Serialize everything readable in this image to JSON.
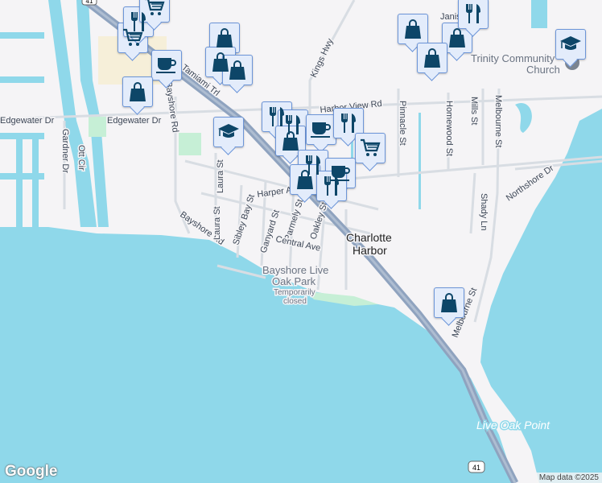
{
  "map": {
    "roads": [
      "Tamiami Trl",
      "Edgewater Dr",
      "Edgewater Dr",
      "Bayshore Rd",
      "Bayshore Rd",
      "Kings Hwy",
      "Harbor View Rd",
      "Gardner Dr",
      "Ott Cir",
      "Laura St",
      "Sibley Bay St",
      "Ganyard St",
      "Parmely St",
      "Oakley St",
      "Harper Ave",
      "Central Ave",
      "Pinnacle St",
      "Homewood St",
      "Mills St",
      "Melbourne St",
      "Melbourne St",
      "Shady Ln",
      "Northshore Dr",
      "Laura St",
      "Janis"
    ],
    "places": {
      "town_line1": "Charlotte",
      "town_line2": "Harbor",
      "park_line1": "Bayshore Live",
      "park_line2": "Oak Park",
      "park_status_line1": "Temporarily",
      "park_status_line2": "closed",
      "church_line1": "Trinity Community",
      "church_line2": "Church",
      "point": "Live Oak Point"
    },
    "shields": [
      "41",
      "41"
    ],
    "markers": [
      "cart",
      "fork",
      "cart",
      "shop",
      "shop",
      "shop",
      "coffee",
      "shop",
      "school",
      "fork",
      "fork",
      "shop",
      "coffee",
      "fork",
      "cart",
      "fork",
      "coffee",
      "shop",
      "fork",
      "shop",
      "shop",
      "shop",
      "fork",
      "school",
      "shop"
    ]
  },
  "footer": {
    "logo": "Google",
    "attribution": "Map data ©2025"
  },
  "colors": {
    "water": "#8fd8ea",
    "land": "#f5f4f6",
    "highway": "#8fa3bf",
    "marker_bg": "#e3ecfb",
    "marker_border": "#6c95d8",
    "icon": "#0d4668"
  }
}
